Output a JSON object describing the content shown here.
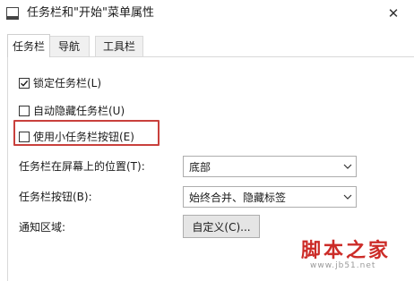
{
  "window": {
    "title": "任务栏和\"开始\"菜单属性",
    "close_glyph": "✕"
  },
  "tabs": [
    {
      "label": "任务栏",
      "active": true
    },
    {
      "label": "导航",
      "active": false
    },
    {
      "label": "工具栏",
      "active": false
    }
  ],
  "options": {
    "lock_taskbar": {
      "label": "锁定任务栏(L)",
      "checked": true
    },
    "auto_hide": {
      "label": "自动隐藏任务栏(U)",
      "checked": false
    },
    "small_buttons": {
      "label": "使用小任务栏按钮(E)",
      "checked": false
    }
  },
  "position": {
    "label": "任务栏在屏幕上的位置(T):",
    "value": "底部"
  },
  "buttons": {
    "label": "任务栏按钮(B):",
    "value": "始终合并、隐藏标签"
  },
  "notification": {
    "label": "通知区域:",
    "button_label": "自定义(C)..."
  },
  "watermark": {
    "brand": "脚本之家",
    "url": "www.jb51.net"
  },
  "colors": {
    "highlight": "#c9403c",
    "watermark": "#cc2c28"
  }
}
